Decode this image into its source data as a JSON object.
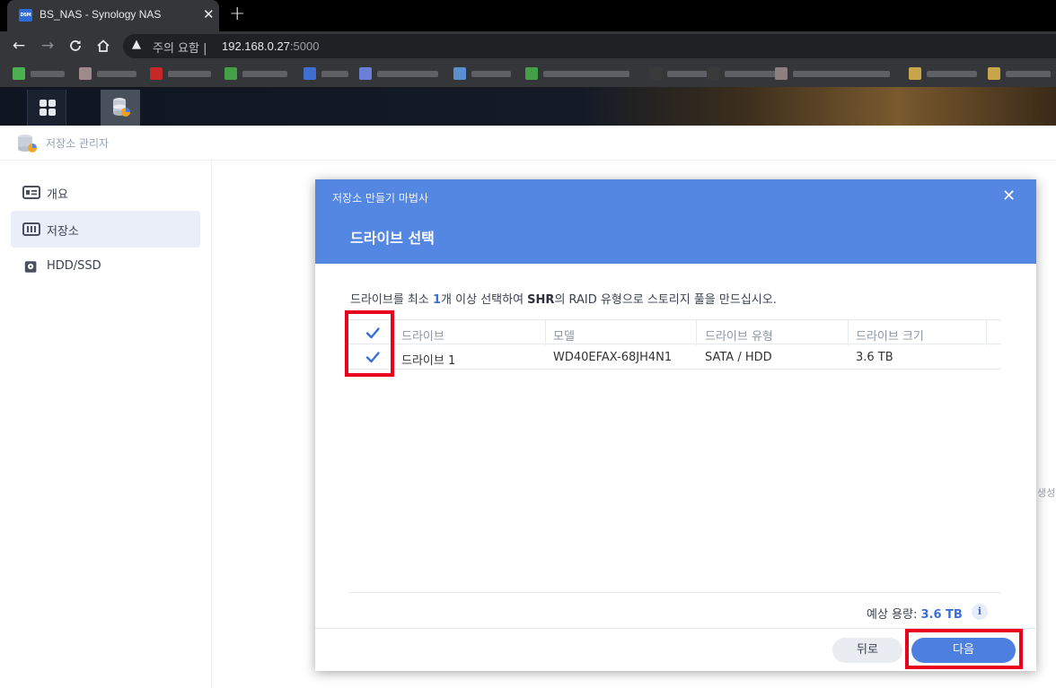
{
  "browser": {
    "tab_title": "BS_NAS - Synology NAS",
    "tab_favicon_text": "DSM",
    "security_warning": "주의 요함",
    "url_host": "192.168.0.27",
    "url_port": ":5000"
  },
  "app": {
    "title": "저장소 관리자"
  },
  "sidebar": {
    "items": [
      {
        "label": "개요",
        "icon": "overview-icon"
      },
      {
        "label": "저장소",
        "icon": "storage-icon",
        "active": true
      },
      {
        "label": "HDD/SSD",
        "icon": "hdd-icon"
      }
    ]
  },
  "background_edge_text": "생성",
  "wizard": {
    "title": "저장소 만들기 마법사",
    "step_title": "드라이브 선택",
    "instruction": {
      "part1": "드라이브를 최소 ",
      "count": "1",
      "part2": "개 이상 선택하여 ",
      "raid": "SHR",
      "part3": "의 RAID 유형으로 스토리지 풀을 만드십시오."
    },
    "table": {
      "headers": [
        "드라이브",
        "모델",
        "드라이브 유형",
        "드라이브 크기"
      ],
      "rows": [
        {
          "checked": true,
          "drive": "드라이브 1",
          "model": "WD40EFAX-68JH4N1",
          "type": "SATA / HDD",
          "size": "3.6 TB"
        }
      ],
      "header_checked": true
    },
    "capacity_label": "예상 용량: ",
    "capacity_value": "3.6 TB",
    "back_button": "뒤로",
    "next_button": "다음"
  },
  "colors": {
    "accent": "#5487e2",
    "primary_button": "#4d7fe0",
    "highlight": "#e8001c"
  }
}
